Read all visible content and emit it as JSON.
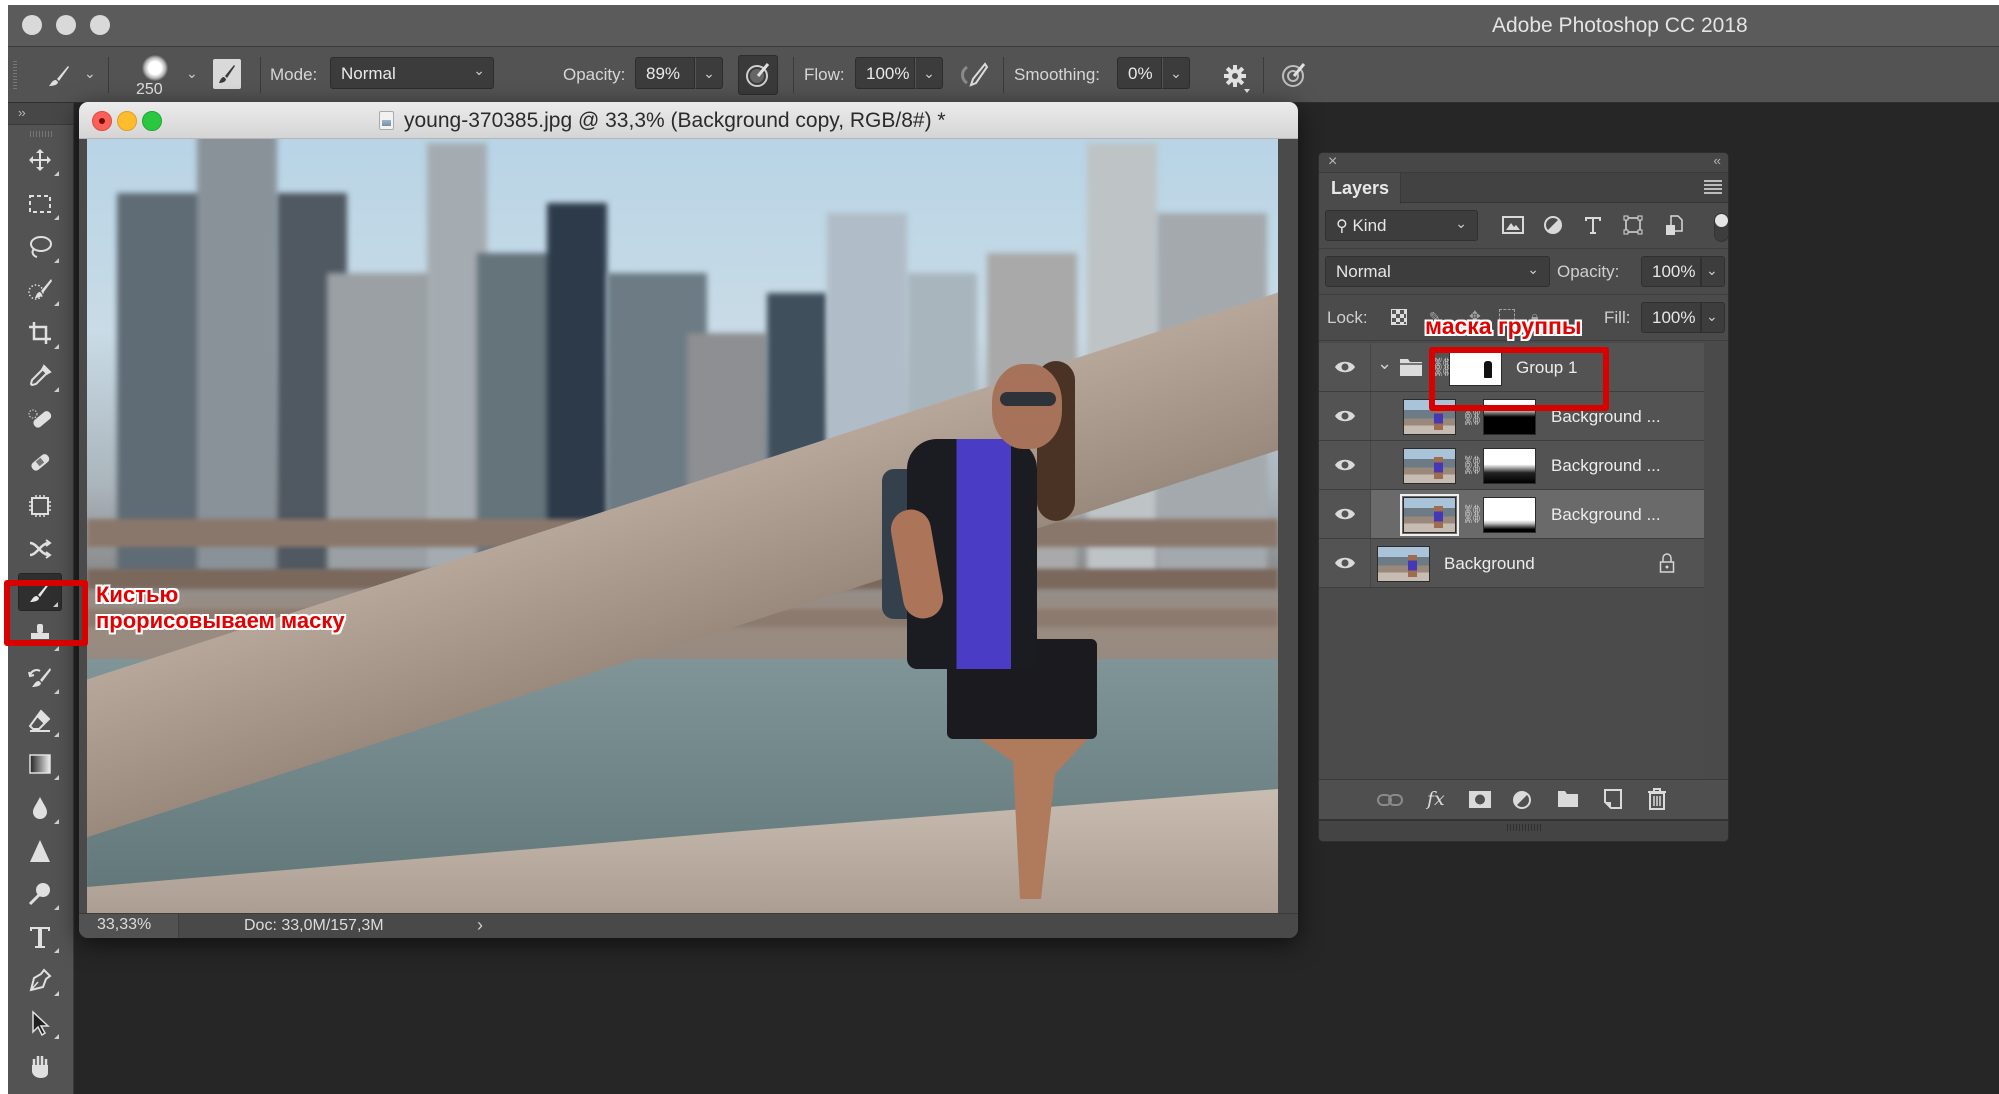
{
  "app": {
    "title": "Adobe Photoshop CC 2018"
  },
  "options_bar": {
    "tool_icon": "brush-icon",
    "brush_size": "250",
    "mode_label": "Mode:",
    "mode_value": "Normal",
    "opacity_label": "Opacity:",
    "opacity_value": "89%",
    "flow_label": "Flow:",
    "flow_value": "100%",
    "smoothing_label": "Smoothing:",
    "smoothing_value": "0%",
    "icons": [
      "brush-preset-icon",
      "brush-panel-toggle-icon",
      "pressure-opacity-icon",
      "airbrush-icon",
      "smoothing-settings-gear-icon",
      "pressure-size-icon"
    ]
  },
  "toolbar": {
    "expand_label": "››",
    "tools": [
      {
        "name": "move-tool",
        "icon": "move-icon"
      },
      {
        "name": "marquee-tool",
        "icon": "rectangular-marquee-icon"
      },
      {
        "name": "lasso-tool",
        "icon": "lasso-icon"
      },
      {
        "name": "quick-selection-tool",
        "icon": "quick-selection-icon"
      },
      {
        "name": "crop-tool",
        "icon": "crop-icon"
      },
      {
        "name": "eyedropper-tool",
        "icon": "eyedropper-icon"
      },
      {
        "name": "spot-healing-tool",
        "icon": "spot-healing-icon"
      },
      {
        "name": "healing-brush-tool",
        "icon": "bandage-icon"
      },
      {
        "name": "content-aware-tool",
        "icon": "content-aware-move-icon"
      },
      {
        "name": "patch-tool",
        "icon": "shuffle-icon"
      },
      {
        "name": "brush-tool",
        "icon": "brush-icon",
        "active": true
      },
      {
        "name": "clone-stamp-tool",
        "icon": "stamp-icon"
      },
      {
        "name": "history-brush-tool",
        "icon": "history-brush-icon"
      },
      {
        "name": "eraser-tool",
        "icon": "eraser-icon"
      },
      {
        "name": "gradient-tool",
        "icon": "gradient-icon"
      },
      {
        "name": "blur-tool",
        "icon": "drop-icon"
      },
      {
        "name": "sharpen-tool",
        "icon": "triangle-icon"
      },
      {
        "name": "dodge-tool",
        "icon": "dodge-icon"
      },
      {
        "name": "type-tool",
        "icon": "type-icon"
      },
      {
        "name": "pen-tool",
        "icon": "pen-icon"
      },
      {
        "name": "path-selection-tool",
        "icon": "arrow-icon"
      },
      {
        "name": "hand-tool",
        "icon": "hand-icon"
      }
    ]
  },
  "document": {
    "title": "young-370385.jpg @ 33,3% (Background copy, RGB/8#) *",
    "zoom": "33,33%",
    "doc_info": "Doc: 33,0M/157,3M",
    "info_arrow": "›"
  },
  "layers_panel": {
    "tab_label": "Layers",
    "close_label": "×",
    "collapse_label": "‹‹",
    "filter_kind": "Kind",
    "filter_icons": [
      "image-filter-icon",
      "adjustment-filter-icon",
      "type-filter-icon",
      "shape-filter-icon",
      "smart-object-filter-icon"
    ],
    "blend_mode": "Normal",
    "opacity_label": "Opacity:",
    "opacity_value": "100%",
    "lock_label": "Lock:",
    "fill_label": "Fill:",
    "fill_value": "100%",
    "layers": [
      {
        "name": "Group 1",
        "type": "group",
        "visible": true,
        "expanded": true,
        "has_mask": true
      },
      {
        "name": "Background ...",
        "type": "pixel",
        "visible": true,
        "has_mask": true,
        "mask_style": "white-top-black-bottom"
      },
      {
        "name": "Background ...",
        "type": "pixel",
        "visible": true,
        "has_mask": true,
        "mask_style": "mostly-white-dark-bottom"
      },
      {
        "name": "Background ...",
        "type": "pixel",
        "visible": true,
        "has_mask": true,
        "mask_style": "white-thin-black-bottom",
        "selected": true
      },
      {
        "name": "Background",
        "type": "background",
        "visible": true,
        "locked": true
      }
    ],
    "bottom_icons": [
      "link-layers-icon",
      "fx-icon",
      "add-mask-icon",
      "adjustment-layer-icon",
      "new-group-icon",
      "new-layer-icon",
      "delete-icon"
    ],
    "fx_label": "fx"
  },
  "annotations": {
    "brush_note_line1": "Кистью",
    "brush_note_line2": "прорисовываем маску",
    "group_mask_note": "маска группы",
    "highlight_color": "#d90000"
  }
}
